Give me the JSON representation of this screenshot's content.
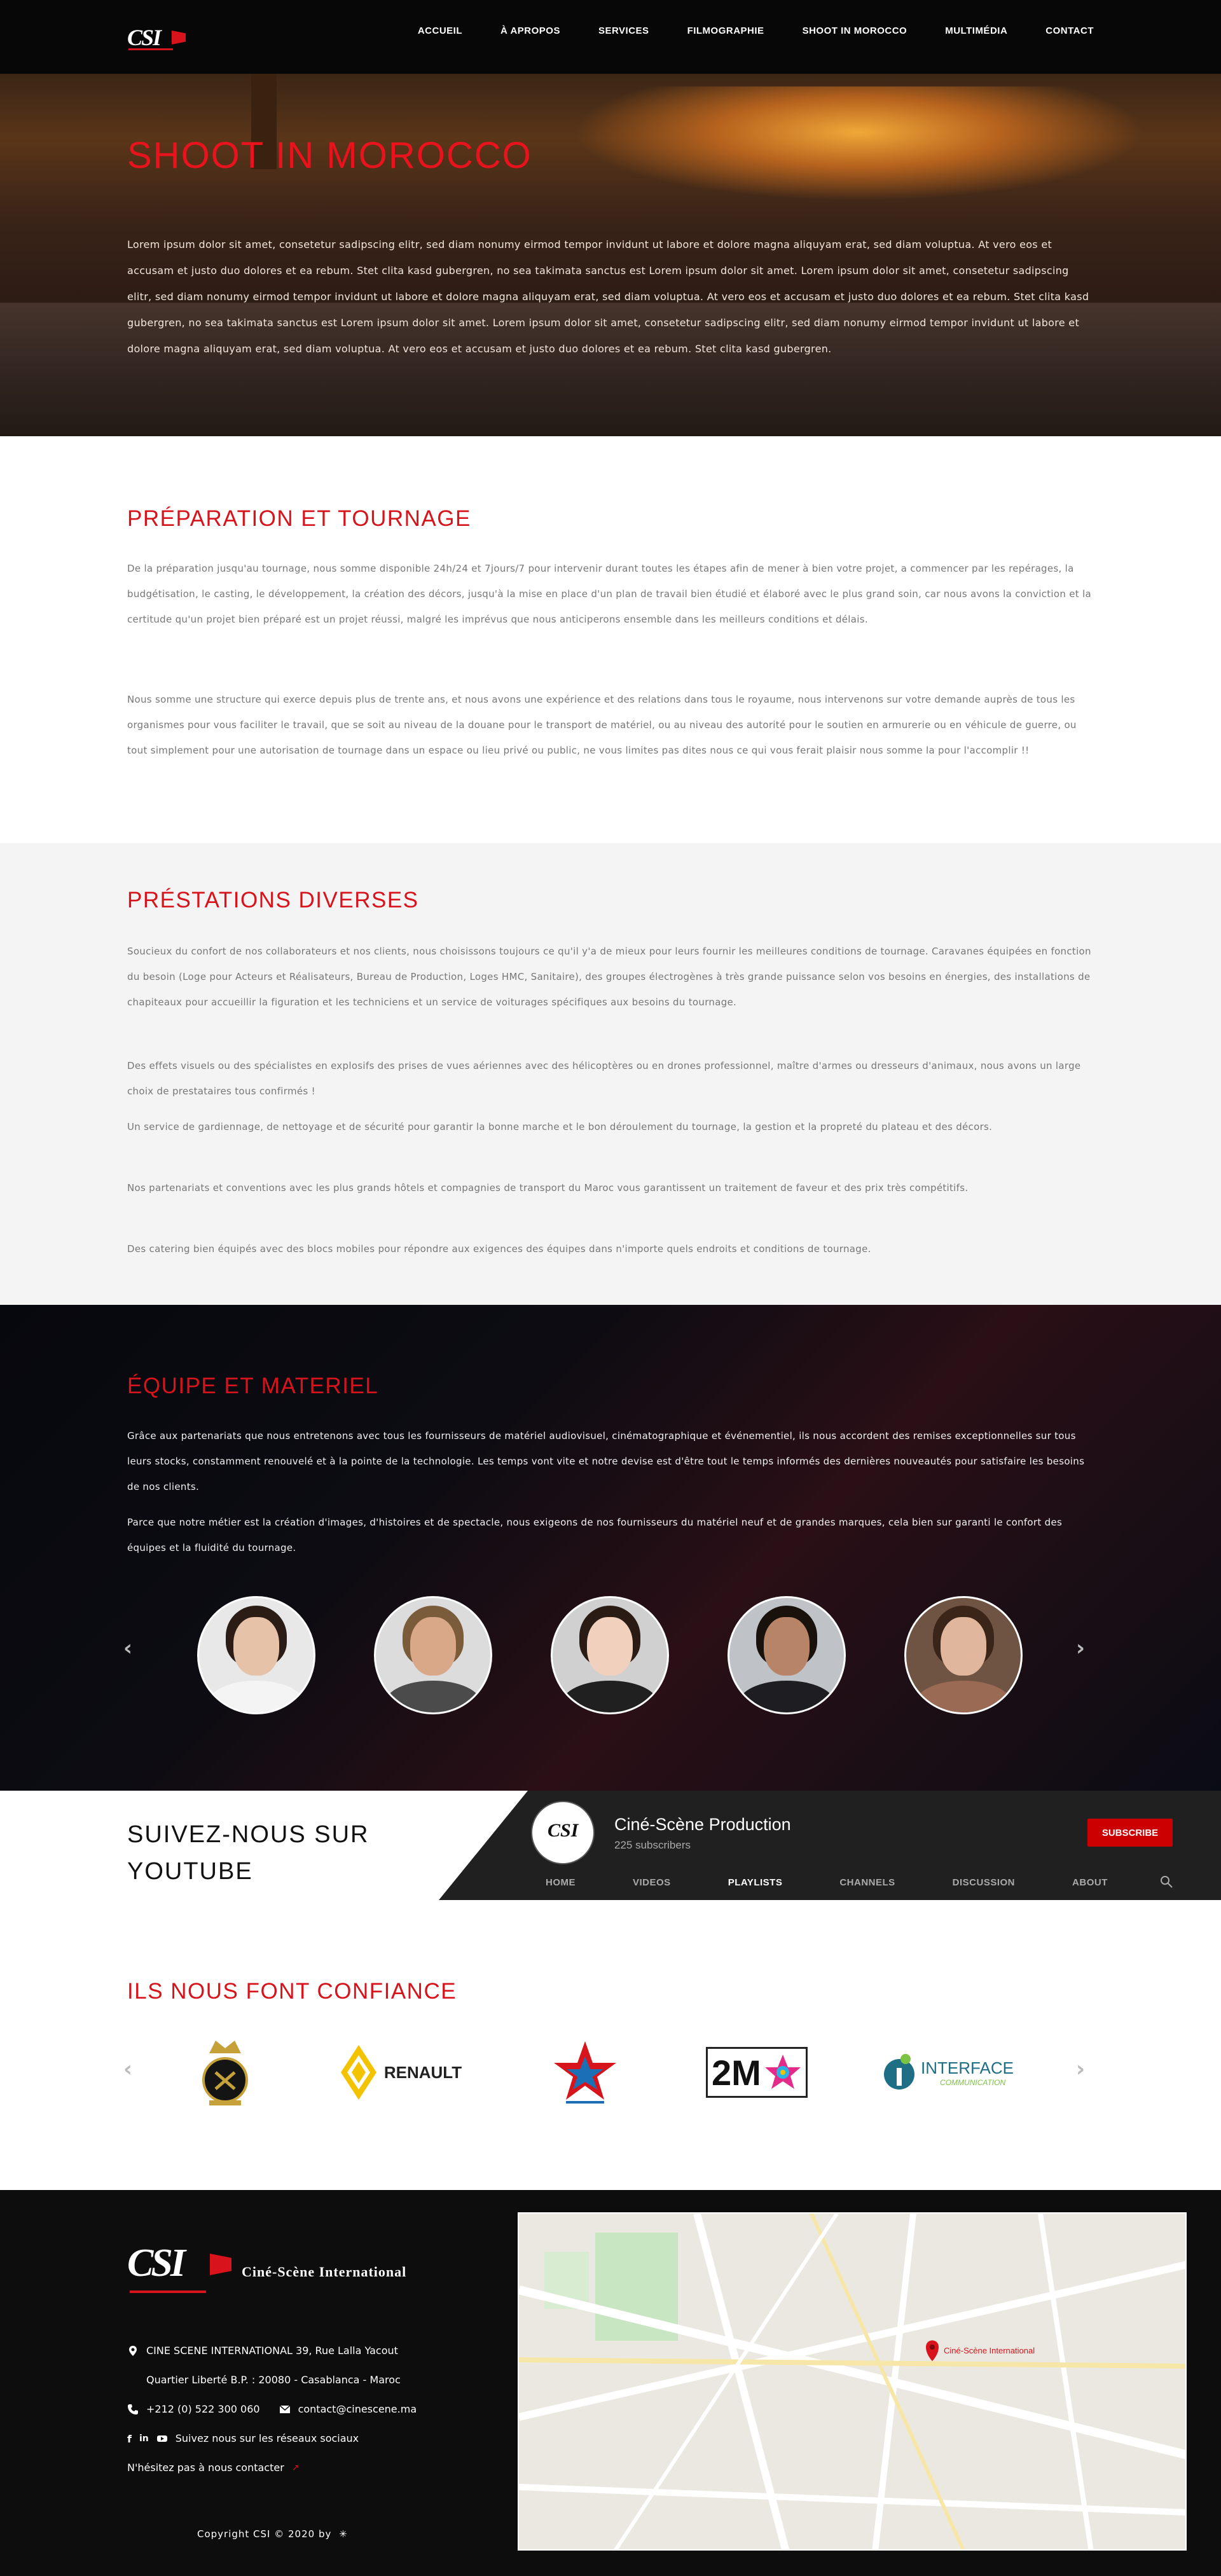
{
  "nav": {
    "items": [
      "ACCUEIL",
      "À APROPOS",
      "SERVICES",
      "FILMOGRAPHIE",
      "SHOOT IN MOROCCO",
      "MULTIMÉDIA",
      "CONTACT"
    ]
  },
  "hero": {
    "title": "SHOOT IN MOROCCO",
    "body": "Lorem ipsum dolor sit amet, consetetur sadipscing elitr, sed diam nonumy eirmod tempor invidunt ut labore et dolore magna aliquyam erat, sed diam voluptua. At vero eos et accusam et justo duo dolores et ea rebum. Stet clita kasd gubergren, no sea takimata sanctus est Lorem ipsum dolor sit amet. Lorem ipsum dolor sit amet, consetetur sadipscing elitr, sed diam nonumy eirmod tempor invidunt ut labore et dolore magna aliquyam erat, sed diam voluptua. At vero eos et accusam et justo duo dolores et ea rebum. Stet clita kasd gubergren, no sea takimata sanctus est Lorem ipsum dolor sit amet. Lorem ipsum dolor sit amet, consetetur sadipscing elitr, sed diam nonumy eirmod tempor invidunt ut labore et dolore magna aliquyam erat, sed diam voluptua. At vero eos et accusam et justo duo dolores et ea rebum. Stet clita kasd gubergren."
  },
  "preparation": {
    "title": "PRÉPARATION ET TOURNAGE",
    "p1": "De la préparation jusqu'au tournage, nous somme disponible 24h/24 et 7jours/7 pour intervenir durant toutes les étapes afin de mener à bien votre projet, a commencer par les repérages, la budgétisation, le casting, le développement, la création des décors, jusqu'à la mise en place d'un plan de travail bien étudié et élaboré avec le plus grand soin, car nous avons la conviction et la certitude qu'un projet bien préparé est un projet réussi, malgré les imprévus que nous anticiperons ensemble dans les meilleurs conditions et délais.",
    "p2": "Nous somme une structure qui exerce depuis plus de trente ans, et nous avons une expérience et des relations dans tous le royaume, nous intervenons sur votre demande auprès de tous les organismes pour vous faciliter le travail, que se soit au niveau de la douane pour le transport de matériel, ou au niveau des autorité pour le soutien en armurerie ou en véhicule de guerre, ou tout simplement pour une autorisation de tournage dans un espace ou lieu privé ou public, ne vous limites pas dites nous ce qui vous ferait plaisir nous somme la pour l'accomplir !!"
  },
  "prestations": {
    "title": "PRÉSTATIONS DIVERSES",
    "p1": "Soucieux du confort de nos collaborateurs et nos clients, nous choisissons toujours ce qu'il y'a de mieux pour leurs fournir les meilleures conditions de tournage. Caravanes équipées en fonction du besoin (Loge pour Acteurs et Réalisateurs, Bureau de Production, Loges HMC, Sanitaire), des groupes électrogènes à très grande puissance selon vos besoins en énergies, des installations de chapiteaux pour accueillir la figuration et les techniciens et un service de voiturages spécifiques aux besoins du tournage.",
    "p2": "Des effets visuels ou des spécialistes en explosifs des prises de vues aériennes avec des hélicoptères ou en drones professionnel, maître d'armes ou dresseurs d'animaux, nous avons un large choix de prestataires tous confirmés !",
    "p3": "Un service de gardiennage, de nettoyage et de sécurité pour garantir la bonne marche et le bon déroulement du tournage, la gestion et la propreté du plateau et des décors.",
    "p4": "Nos partenariats et conventions avec les plus grands hôtels et compagnies de transport du Maroc vous garantissent un traitement de faveur et des prix très compétitifs.",
    "p5": "Des catering bien équipés avec des blocs mobiles pour répondre aux exigences des équipes dans n'importe quels endroits et conditions de tournage."
  },
  "equipe": {
    "title": "ÉQUIPE ET MATERIEL",
    "p1": "Grâce aux partenariats que nous entretenons avec tous les fournisseurs de matériel audiovisuel, cinématographique et événementiel, ils nous accordent des remises exceptionnelles sur tous leurs stocks, constamment renouvelé et à la pointe de la technologie. Les temps vont vite et notre devise est d'être tout le temps informés des dernières nouveautés pour satisfaire les besoins de nos clients.",
    "p2": "Parce que notre métier est la création d'images, d'histoires et de spectacle, nous exigeons de nos fournisseurs du matériel neuf et de grandes marques, cela bien sur garanti le confort des équipes et la fluidité du tournage.",
    "prev": "‹",
    "next": "›"
  },
  "youtube": {
    "heading_line1": "SUIVEZ-NOUS SUR",
    "heading_line2": "YOUTUBE",
    "avatar_text": "CSI",
    "channel": "Ciné-Scène Production",
    "subscribers": "225 subscribers",
    "subscribe": "SUBSCRIBE",
    "tabs": [
      "HOME",
      "VIDEOS",
      "PLAYLISTS",
      "CHANNELS",
      "DISCUSSION",
      "ABOUT"
    ],
    "active_tab": "PLAYLISTS"
  },
  "trust": {
    "title": "ILS NOUS FONT CONFIANCE",
    "logos": [
      "RENAULT",
      "2M",
      "INTERFACE"
    ],
    "logo_sub_interface": "COMMUNICATION",
    "prev": "‹",
    "next": "›"
  },
  "footer": {
    "logo": "CSI",
    "company": "Ciné-Scène International",
    "address1": "CINE SCENE INTERNATIONAL 39, Rue Lalla Yacout",
    "address2": "Quartier Liberté B.P. : 20080 - Casablanca - Maroc",
    "phone": "+212 (0) 522 300 060",
    "email": "contact@cinescene.ma",
    "social": "Suivez nous sur les réseaux sociaux",
    "contact_prompt": "N'hésitez pas à nous contacter",
    "copyright": "Copyright CSI © 2020 by",
    "map_pin": "Ciné-Scène International"
  }
}
